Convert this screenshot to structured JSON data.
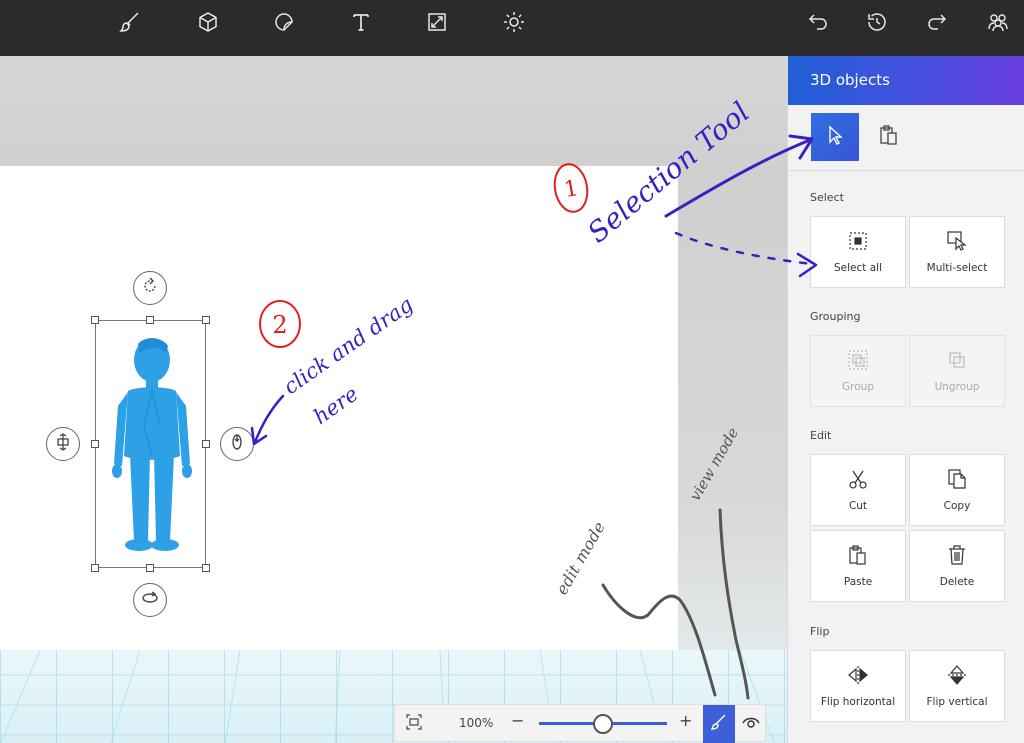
{
  "toolbar": {
    "left_tools": [
      {
        "icon": "brush-icon"
      },
      {
        "icon": "3d-cube-icon"
      },
      {
        "icon": "sticker-icon"
      },
      {
        "icon": "text-icon"
      },
      {
        "icon": "canvas-icon"
      },
      {
        "icon": "effects-icon"
      }
    ],
    "right_tools": [
      {
        "icon": "undo-icon"
      },
      {
        "icon": "history-icon"
      },
      {
        "icon": "redo-icon"
      },
      {
        "icon": "community-icon"
      }
    ]
  },
  "panel": {
    "title": "3D objects",
    "sections": {
      "select": {
        "label": "Select",
        "buttons": [
          {
            "label": "Select all"
          },
          {
            "label": "Multi-select"
          }
        ]
      },
      "grouping": {
        "label": "Grouping",
        "buttons": [
          {
            "label": "Group"
          },
          {
            "label": "Ungroup"
          }
        ]
      },
      "edit": {
        "label": "Edit",
        "buttons": [
          {
            "label": "Cut"
          },
          {
            "label": "Copy"
          },
          {
            "label": "Paste"
          },
          {
            "label": "Delete"
          }
        ]
      },
      "flip": {
        "label": "Flip",
        "buttons": [
          {
            "label": "Flip horizontal"
          },
          {
            "label": "Flip vertical"
          }
        ]
      }
    }
  },
  "viewbar": {
    "zoom": "100%",
    "zoom_fraction": 0.5,
    "minus": "−",
    "plus": "+"
  },
  "annotations": {
    "step1_number": "1",
    "step1_text": "Selection Tool",
    "step2_number": "2",
    "step2_line1": "click and drag",
    "step2_line2": "here",
    "edit_mode": "edit mode",
    "view_mode": "view mode"
  },
  "colors": {
    "toolbar_bg": "#2b2b2b",
    "accent": "#3d5fd8",
    "figure": "#2ea0e6",
    "ink_purple": "#3a1ec0",
    "ink_red": "#e02020",
    "ink_gray": "#555555"
  }
}
